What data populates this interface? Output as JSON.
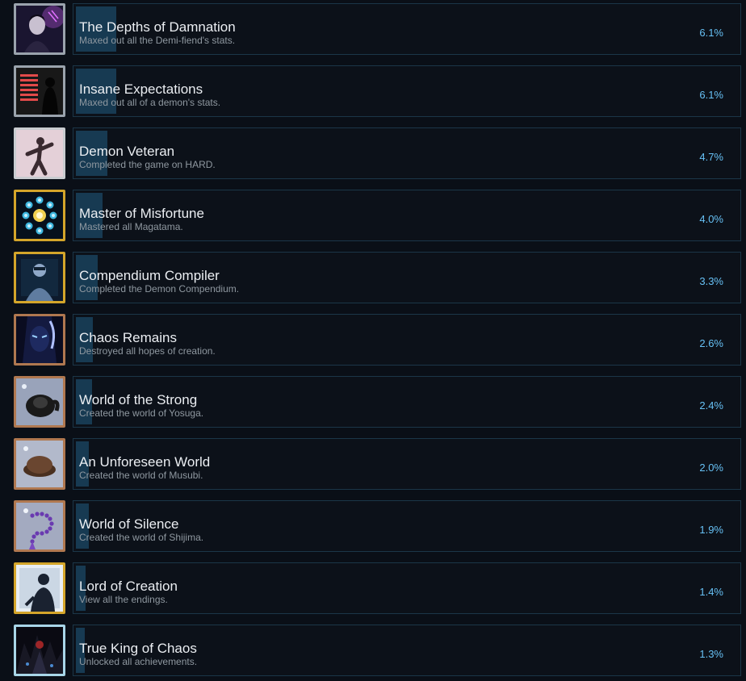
{
  "achievements": [
    {
      "icon": "demi-fiend-portrait-icon",
      "frame": "#9aa3ad",
      "title": "The Depths of Damnation",
      "description": "Maxed out all the Demi-fiend's stats.",
      "percent_label": "6.1%",
      "percent": 6.1
    },
    {
      "icon": "demon-silhouette-icon",
      "frame": "#9aa3ad",
      "title": "Insane Expectations",
      "description": "Maxed out all of a demon's stats.",
      "percent_label": "6.1%",
      "percent": 6.1
    },
    {
      "icon": "dancing-figure-icon",
      "frame": "#c9ccd0",
      "title": "Demon Veteran",
      "description": "Completed the game on HARD.",
      "percent_label": "4.7%",
      "percent": 4.7
    },
    {
      "icon": "magatama-ring-icon",
      "frame": "#d4a52a",
      "title": "Master of Misfortune",
      "description": "Mastered all Magatama.",
      "percent_label": "4.0%",
      "percent": 4.0
    },
    {
      "icon": "compendium-figure-icon",
      "frame": "#d4a52a",
      "title": "Compendium Compiler",
      "description": "Completed the Demon Compendium.",
      "percent_label": "3.3%",
      "percent": 3.3
    },
    {
      "icon": "chaos-face-icon",
      "frame": "#b07850",
      "title": "Chaos Remains",
      "description": "Destroyed all hopes of creation.",
      "percent_label": "2.6%",
      "percent": 2.6
    },
    {
      "icon": "yosuga-helmet-icon",
      "frame": "#b07850",
      "title": "World of the Strong",
      "description": "Created the world of Yosuga.",
      "percent_label": "2.4%",
      "percent": 2.4
    },
    {
      "icon": "musubi-hat-icon",
      "frame": "#b07850",
      "title": "An Unforeseen World",
      "description": "Created the world of Musubi.",
      "percent_label": "2.0%",
      "percent": 2.0
    },
    {
      "icon": "shijima-beads-icon",
      "frame": "#b07850",
      "title": "World of Silence",
      "description": "Created the world of Shijima.",
      "percent_label": "1.9%",
      "percent": 1.9
    },
    {
      "icon": "creation-figure-icon",
      "frame": "#d4a52a",
      "title": "Lord of Creation",
      "description": "View all the endings.",
      "percent_label": "1.4%",
      "percent": 1.4
    },
    {
      "icon": "chaos-king-icon",
      "frame": "#a8d6e8",
      "title": "True King of Chaos",
      "description": "Unlocked all achievements.",
      "percent_label": "1.3%",
      "percent": 1.3
    }
  ]
}
